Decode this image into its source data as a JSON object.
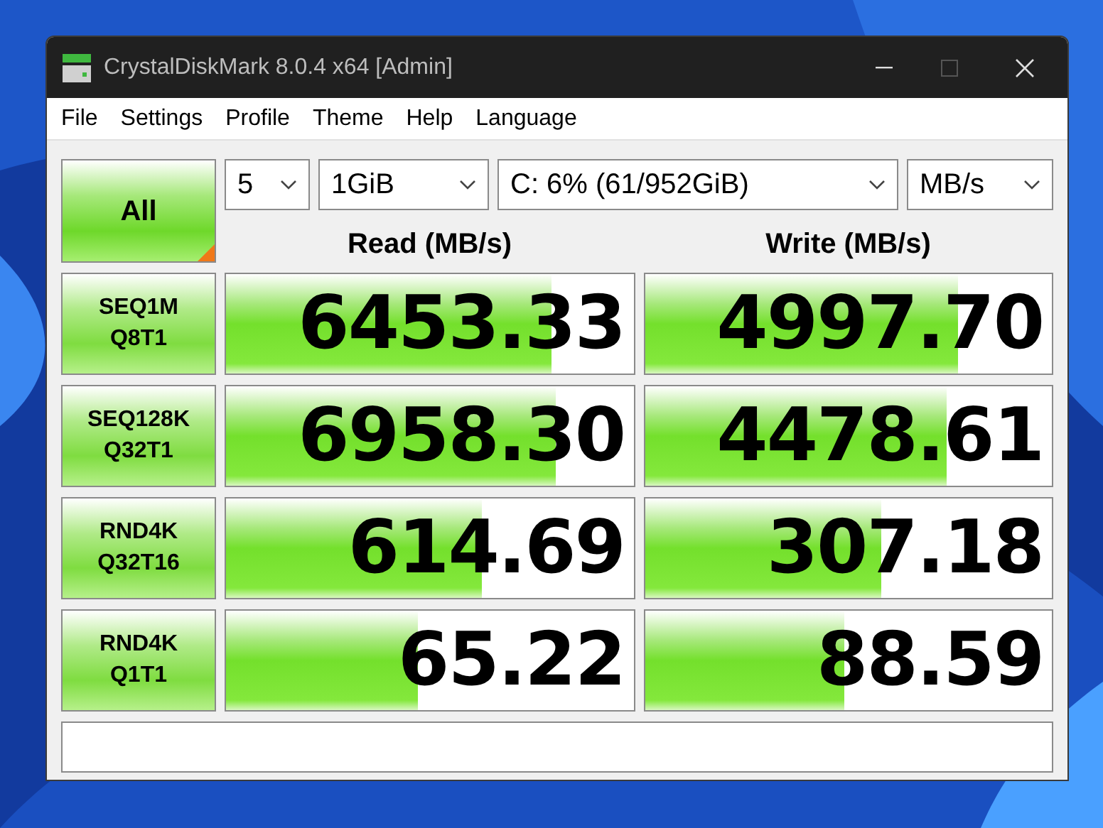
{
  "window": {
    "title": "CrystalDiskMark 8.0.4 x64 [Admin]",
    "maximize_disabled": true
  },
  "menu": [
    "File",
    "Settings",
    "Profile",
    "Theme",
    "Help",
    "Language"
  ],
  "all_button": {
    "label": "All"
  },
  "selectors": [
    {
      "value": "5"
    },
    {
      "value": "1GiB"
    },
    {
      "value": "C: 6% (61/952GiB)"
    },
    {
      "value": "MB/s"
    }
  ],
  "columns": [
    "Read (MB/s)",
    "Write (MB/s)"
  ],
  "tests": [
    {
      "name": "SEQ1M",
      "params": "Q8T1",
      "read": {
        "value": "6453.33",
        "level": 0.8
      },
      "write": {
        "value": "4997.70",
        "level": 0.77
      }
    },
    {
      "name": "SEQ128K",
      "params": "Q32T1",
      "read": {
        "value": "6958.30",
        "level": 0.81
      },
      "write": {
        "value": "4478.61",
        "level": 0.74
      }
    },
    {
      "name": "RND4K",
      "params": "Q32T16",
      "read": {
        "value": "614.69",
        "level": 0.63
      },
      "write": {
        "value": "307.18",
        "level": 0.58
      }
    },
    {
      "name": "RND4K",
      "params": "Q1T1",
      "read": {
        "value": "65.22",
        "level": 0.47
      },
      "write": {
        "value": "88.59",
        "level": 0.49
      }
    }
  ]
}
